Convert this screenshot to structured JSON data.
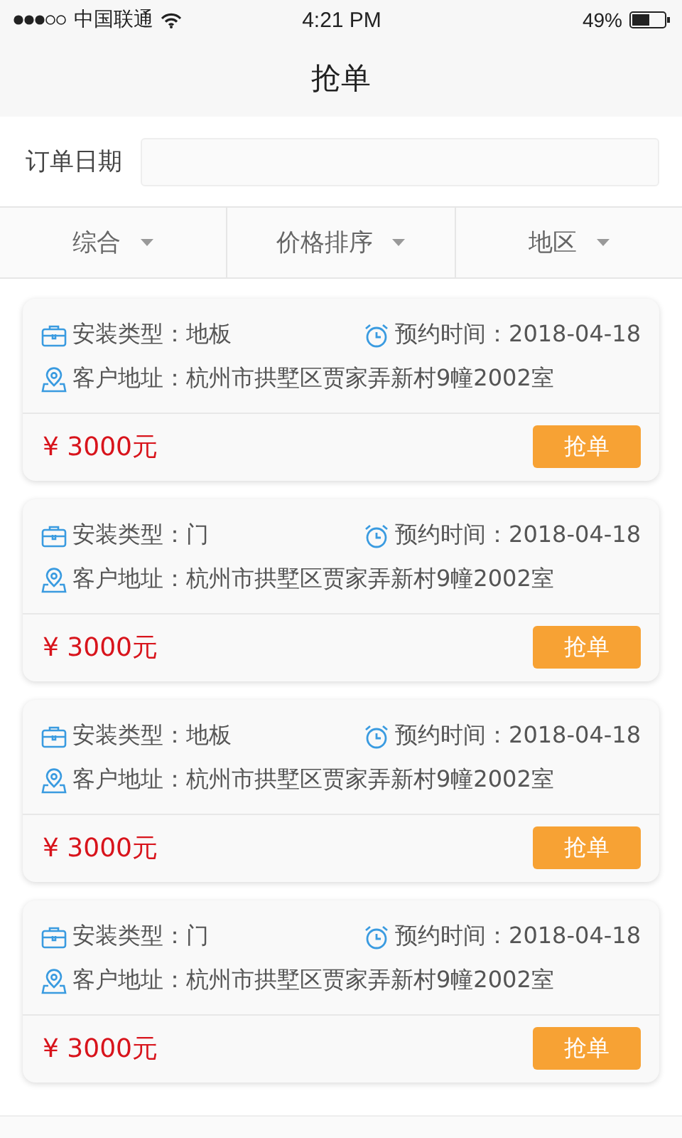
{
  "status_bar": {
    "carrier": "中国联通",
    "time": "4:21 PM",
    "battery": "49%"
  },
  "nav": {
    "title": "抢单"
  },
  "date_filter": {
    "label": "订单日期"
  },
  "sort_tabs": [
    {
      "label": "综合"
    },
    {
      "label": "价格排序"
    },
    {
      "label": "地区"
    }
  ],
  "orders": [
    {
      "type_label": "安装类型：",
      "type": "地板",
      "time_label": "预约时间：",
      "time": "2018-04-18",
      "address_label": "客户地址：",
      "address": "杭州市拱墅区贾家弄新村9幢2002室",
      "price": "¥ 3000元",
      "button": "抢单"
    },
    {
      "type_label": "安装类型：",
      "type": "门",
      "time_label": "预约时间：",
      "time": "2018-04-18",
      "address_label": "客户地址：",
      "address": "杭州市拱墅区贾家弄新村9幢2002室",
      "price": "¥ 3000元",
      "button": "抢单"
    },
    {
      "type_label": "安装类型：",
      "type": "地板",
      "time_label": "预约时间：",
      "time": "2018-04-18",
      "address_label": "客户地址：",
      "address": "杭州市拱墅区贾家弄新村9幢2002室",
      "price": "¥ 3000元",
      "button": "抢单"
    },
    {
      "type_label": "安装类型：",
      "type": "门",
      "time_label": "预约时间：",
      "time": "2018-04-18",
      "address_label": "客户地址：",
      "address": "杭州市拱墅区贾家弄新村9幢2002室",
      "price": "¥ 3000元",
      "button": "抢单"
    }
  ]
}
